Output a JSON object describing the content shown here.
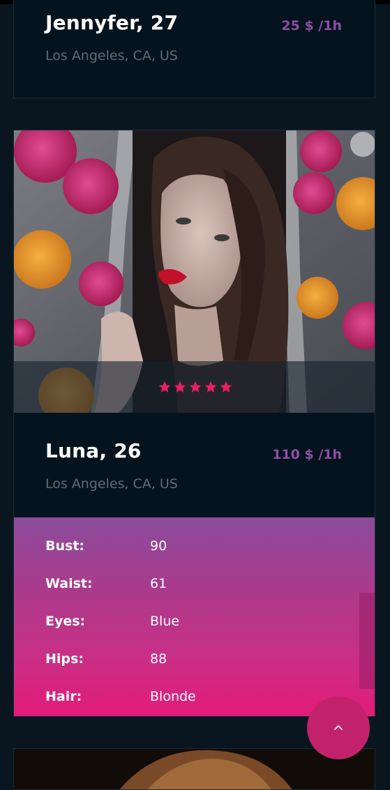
{
  "profiles": [
    {
      "name": "Jennyfer, 27",
      "price": "25 $ /1h",
      "location": "Los Angeles, CA, US"
    },
    {
      "name": "Luna, 26",
      "price": "110 $ /1h",
      "location": "Los Angeles, CA, US",
      "rating": 5,
      "specs": [
        {
          "label": "Bust:",
          "value": "90"
        },
        {
          "label": "Waist:",
          "value": "61"
        },
        {
          "label": "Eyes:",
          "value": "Blue"
        },
        {
          "label": "Hips:",
          "value": "88"
        },
        {
          "label": "Hair:",
          "value": "Blonde"
        }
      ]
    }
  ],
  "icons": {
    "star": "star-icon",
    "back_to_top": "chevron-up-icon"
  },
  "colors": {
    "background": "#091620",
    "card": "#04131d",
    "price": "#8e4ea5",
    "star": "#e91e63",
    "specs_gradient_top": "#8a4b9c",
    "specs_gradient_bottom": "#e31b78",
    "back_to_top": "#c2226b"
  }
}
